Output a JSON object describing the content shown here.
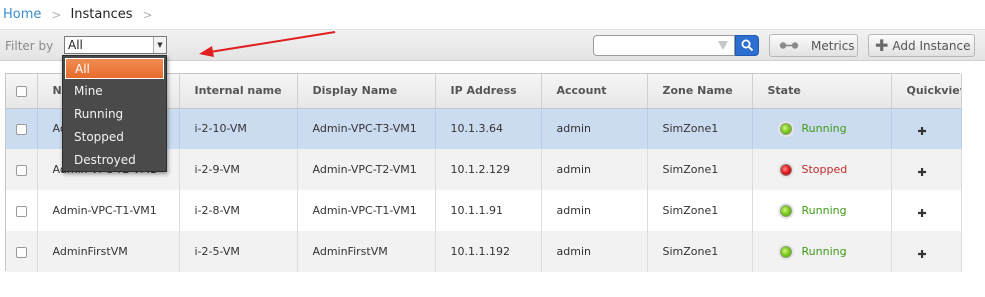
{
  "breadcrumb": {
    "home": "Home",
    "separator": ">",
    "current": "Instances",
    "trailing_separator": ">"
  },
  "toolbar": {
    "filter_label": "Filter by",
    "filter_value": "All",
    "search_placeholder": "",
    "metrics_label": "Metrics",
    "add_label": "Add Instance"
  },
  "filter_dropdown": {
    "options": [
      "All",
      "Mine",
      "Running",
      "Stopped",
      "Destroyed"
    ],
    "selected": "All"
  },
  "grid": {
    "columns": [
      "Name",
      "Internal name",
      "Display Name",
      "IP Address",
      "Account",
      "Zone Name",
      "State",
      "Quickview"
    ],
    "rows": [
      {
        "name": "Admin-VPC-T3-VM1",
        "internal": "i-2-10-VM",
        "display": "Admin-VPC-T3-VM1",
        "ip": "10.1.3.64",
        "account": "admin",
        "zone": "SimZone1",
        "state": "Running"
      },
      {
        "name": "Admin-VPC-T2-VM1",
        "internal": "i-2-9-VM",
        "display": "Admin-VPC-T2-VM1",
        "ip": "10.1.2.129",
        "account": "admin",
        "zone": "SimZone1",
        "state": "Stopped"
      },
      {
        "name": "Admin-VPC-T1-VM1",
        "internal": "i-2-8-VM",
        "display": "Admin-VPC-T1-VM1",
        "ip": "10.1.1.91",
        "account": "admin",
        "zone": "SimZone1",
        "state": "Running"
      },
      {
        "name": "AdminFirstVM",
        "internal": "i-2-5-VM",
        "display": "AdminFirstVM",
        "ip": "10.1.1.192",
        "account": "admin",
        "zone": "SimZone1",
        "state": "Running"
      }
    ],
    "quickview_icon": "plus-icon"
  },
  "colors": {
    "link": "#3b8dd0",
    "selected_row": "#cbdcf0",
    "running": "#3f9a17",
    "stopped": "#c62a2a",
    "dropdown_bg": "#4a4a4a",
    "dropdown_selected": "#e66b2c",
    "annotation_arrow": "#e02020",
    "search_button": "#2d6fd1"
  }
}
